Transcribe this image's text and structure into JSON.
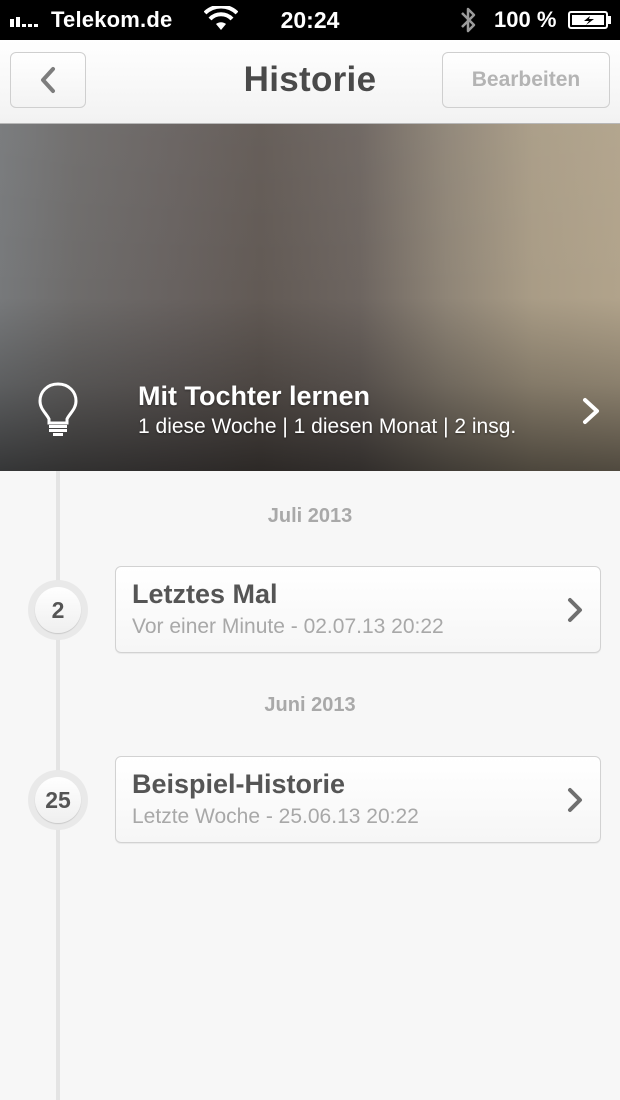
{
  "status_bar": {
    "carrier": "Telekom.de",
    "time": "20:24",
    "battery": "100 %"
  },
  "nav": {
    "title": "Historie",
    "edit_label": "Bearbeiten"
  },
  "habit": {
    "title": "Mit Tochter lernen",
    "stats": "1 diese Woche | 1 diesen Monat | 2 insg."
  },
  "months": [
    {
      "label": "Juli 2013",
      "entries": [
        {
          "day": "2",
          "title": "Letztes Mal",
          "subtitle": "Vor einer Minute - 02.07.13 20:22"
        }
      ]
    },
    {
      "label": "Juni 2013",
      "entries": [
        {
          "day": "25",
          "title": "Beispiel-Historie",
          "subtitle": "Letzte Woche - 25.06.13 20:22"
        }
      ]
    }
  ],
  "colors": {
    "title_text": "#4a4a4a",
    "muted_text": "#a8a8a8",
    "background": "#f7f7f7"
  },
  "icons": {
    "back": "chevron-left-icon",
    "banner_left": "lightbulb-icon",
    "banner_right": "chevron-right-icon",
    "card": "chevron-right-icon"
  }
}
